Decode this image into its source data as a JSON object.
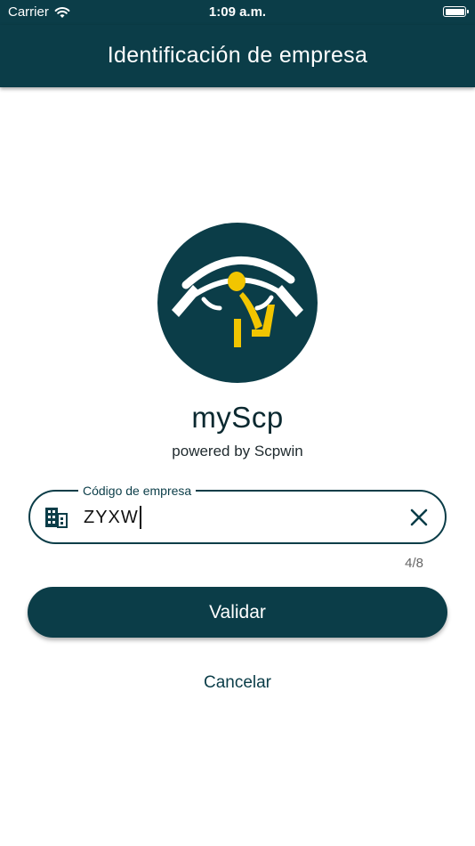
{
  "status_bar": {
    "carrier": "Carrier",
    "time": "1:09 a.m.",
    "icons": [
      "wifi-icon",
      "battery-icon"
    ]
  },
  "header": {
    "title": "Identificación de empresa"
  },
  "logo": {
    "icon": "myscp-logo",
    "colors": {
      "background": "#0b3d48",
      "accent": "#f2c500",
      "stroke": "#ffffff"
    }
  },
  "app": {
    "name": "myScp",
    "powered_by": "powered by Scpwin"
  },
  "form": {
    "label": "Código de empresa",
    "value": "ZYXW",
    "counter": "4/8",
    "leading_icon": "building-icon",
    "trailing_icon": "close-icon"
  },
  "actions": {
    "validate_label": "Validar",
    "cancel_label": "Cancelar"
  },
  "colors": {
    "primary": "#0b3d48",
    "background": "#ffffff"
  }
}
